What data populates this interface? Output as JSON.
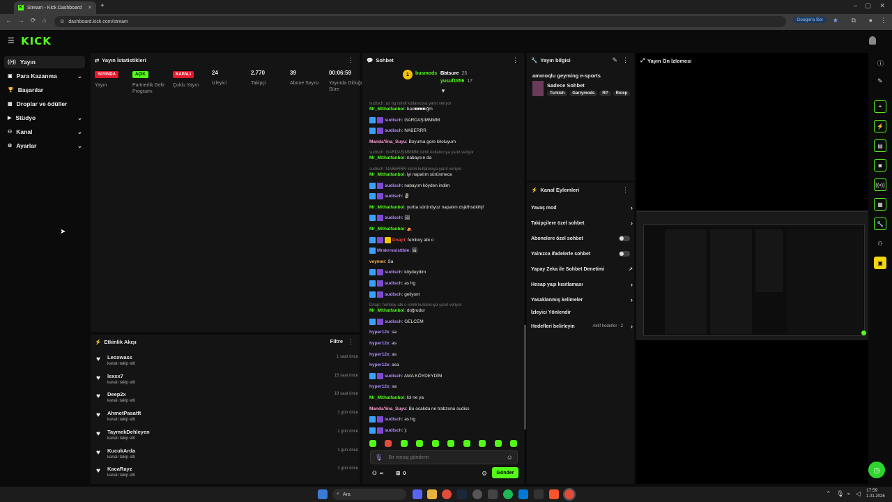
{
  "browser": {
    "tab_title": "Stream - Kick Dashboard",
    "url": "dashboard.kick.com/stream",
    "google_button": "Google'a Sor"
  },
  "app": {
    "logo": "KICK"
  },
  "sidebar": {
    "items": [
      {
        "label": "Yayın",
        "icon": "broadcast-icon",
        "chevron": false,
        "active": true
      },
      {
        "label": "Para Kazanma",
        "icon": "money-icon",
        "chevron": true
      },
      {
        "label": "Başarılar",
        "icon": "trophy-icon",
        "chevron": false
      },
      {
        "label": "Droplar ve ödüller",
        "icon": "gift-icon",
        "chevron": false
      },
      {
        "label": "Stüdyo",
        "icon": "camera-icon",
        "chevron": true
      },
      {
        "label": "Kanal",
        "icon": "channel-icon",
        "chevron": true
      },
      {
        "label": "Ayarlar",
        "icon": "gear-icon",
        "chevron": true
      }
    ]
  },
  "stats": {
    "title": "Yayın İstatistikleri",
    "items": [
      {
        "badge": "YAYINDA",
        "badge_color": "#e3192c",
        "label": "Yayın"
      },
      {
        "badge": "AÇIK",
        "badge_color": "#53fc18",
        "label": "Partnerlik Gelir Programı"
      },
      {
        "badge": "KAPALI",
        "badge_color": "#e3192c",
        "label": "Çoklu Yayın"
      },
      {
        "value": "24",
        "label": "İzleyici"
      },
      {
        "value": "2.770",
        "label": "Takipçi"
      },
      {
        "value": "39",
        "label": "Abone Sayısı"
      },
      {
        "value": "00:06:59",
        "label": "Yayında Olduğu Süre"
      }
    ]
  },
  "activity": {
    "title": "Etkinlik Akışı",
    "filter": "Filtre",
    "items": [
      {
        "name": "Leoxwass",
        "sub": "kanalı takip etti",
        "time": "1 saat önce"
      },
      {
        "name": "lexxx7",
        "sub": "kanalı takip etti",
        "time": "15 saat önce"
      },
      {
        "name": "Deep2x",
        "sub": "kanalı takip etti",
        "time": "19 saat önce"
      },
      {
        "name": "AhmetPasatft",
        "sub": "kanalı takip etti",
        "time": "1 gün önce"
      },
      {
        "name": "TaymekDehleyen",
        "sub": "kanalı takip etti",
        "time": "1 gün önce"
      },
      {
        "name": "KucukArda",
        "sub": "kanalı takip etti",
        "time": "1 gün önce"
      },
      {
        "name": "KacaRayz",
        "sub": "kanalı takip etti",
        "time": "1 gün önce"
      }
    ]
  },
  "chat": {
    "title": "Sohbet",
    "top_gifters": [
      {
        "name": "busmods",
        "count": "38"
      },
      {
        "name": "Gatsure",
        "count": "25"
      },
      {
        "name": "yusuf1856",
        "count": "17"
      }
    ],
    "messages": [
      {
        "reply": "sudisch: as hg isimli kullanıcıya yanıt veriyor"
      },
      {
        "user": "Mr_Mithatfanboi",
        "color": "#53fc18",
        "text": "bac■■■■ığm"
      },
      {
        "user": "sudisch",
        "color": "#b38aff",
        "text": "GARDAŞIMMMM",
        "badges": 2
      },
      {
        "user": "sudisch",
        "color": "#b38aff",
        "text": "NABERRR",
        "badges": 2
      },
      {
        "user": "Manda'lina_Suyu",
        "color": "#ff9bd0",
        "text": "Boyuma gore kiloluyum"
      },
      {
        "reply": "sudisch: GARDAŞIMMMM isimli kullanıcıya yanıt veriyor"
      },
      {
        "user": "Mr_Mithatfanboi",
        "color": "#53fc18",
        "text": "nabaysın da"
      },
      {
        "reply": "sudisch: NABERRR isimli kullanıcıya yanıt veriyor"
      },
      {
        "user": "Mr_Mithatfanboi",
        "color": "#53fc18",
        "text": "iyi napalım sürünmece"
      },
      {
        "user": "sudisch",
        "color": "#b38aff",
        "text": "nabayım köyden indim",
        "badges": 2
      },
      {
        "user": "sudisch",
        "color": "#b38aff",
        "text": "🗿",
        "badges": 2
      },
      {
        "user": "Mr_Mithatfanboi",
        "color": "#53fc18",
        "text": "yurtta sürünüyoz napalım dsjkfhsdklhjf"
      },
      {
        "user": "sudisch",
        "color": "#b38aff",
        "text": "🖼",
        "badges": 2
      },
      {
        "user": "Mr_Mithatfanboi",
        "color": "#53fc18",
        "text": "⛺"
      },
      {
        "user": "Dnajri",
        "color": "#ff3b3b",
        "text": "femboy abi o",
        "badges": 3
      },
      {
        "user": "Mrskrresistible",
        "color": "#b38aff",
        "text": "🖼",
        "badges": 1
      },
      {
        "user": "veymer",
        "color": "#ffb347",
        "text": "Sa"
      },
      {
        "user": "sudisch",
        "color": "#b38aff",
        "text": "köydeydim",
        "badges": 2
      },
      {
        "user": "sudisch",
        "color": "#b38aff",
        "text": "as hg",
        "badges": 2
      },
      {
        "user": "sudisch",
        "color": "#b38aff",
        "text": "geliyom",
        "badges": 2
      },
      {
        "reply": "Dnajri: femboy abi o isimli kullanıcıya yanıt veriyor"
      },
      {
        "user": "Mr_Mithatfanboi",
        "color": "#53fc18",
        "text": "doğrudur"
      },
      {
        "user": "sudisch",
        "color": "#b38aff",
        "text": "GELCEM",
        "badges": 2
      },
      {
        "user": "hyper12x",
        "color": "#b38aff",
        "text": "sa"
      },
      {
        "user": "hyper12x",
        "color": "#b38aff",
        "text": "as"
      },
      {
        "user": "hyper12x",
        "color": "#b38aff",
        "text": "as"
      },
      {
        "user": "hyper12x",
        "color": "#b38aff",
        "text": "asa"
      },
      {
        "user": "sudisch",
        "color": "#b38aff",
        "text": "AMA KÖYDEYDİM",
        "badges": 2
      },
      {
        "user": "hyper12x",
        "color": "#b38aff",
        "text": "sa"
      },
      {
        "user": "Mr_Mithatfanboi",
        "color": "#53fc18",
        "text": "lol ne ya"
      },
      {
        "user": "Manda'lina_Suyu",
        "color": "#ff9bd0",
        "text": "Bu ocakda ne trabzonu sudiss"
      },
      {
        "user": "sudisch",
        "color": "#b38aff",
        "text": "as hg",
        "badges": 2
      },
      {
        "user": "sudisch",
        "color": "#b38aff",
        "text": "):",
        "badges": 2
      }
    ],
    "input_placeholder": "Bir mesaj gönderin",
    "viewer_count": "∞",
    "gift_count": "0",
    "send_label": "Gönder"
  },
  "stream_info": {
    "title": "Yayın bilgisi",
    "stream_title": "amınoqlu geyming e-sports",
    "category": "Sadece Sohbet",
    "tags": [
      "Turkish",
      "Garrymods",
      "RP",
      "Rolep"
    ]
  },
  "channel_actions": {
    "title": "Kanal Eylemleri",
    "items": [
      {
        "label": "Yavaş mod",
        "type": "arrow"
      },
      {
        "label": "Takipçilere özel sohbet",
        "type": "arrow"
      },
      {
        "label": "Abonelere özel sohbet",
        "type": "toggle"
      },
      {
        "label": "Yalnızca ifadelerle sohbet",
        "type": "toggle"
      },
      {
        "label": "Yapay Zeka ile Sohbet Denetimi",
        "type": "external"
      },
      {
        "label": "Hesap yaşı kısıtlaması",
        "type": "arrow"
      },
      {
        "label": "Yasaklanmış kelimeler",
        "type": "arrow"
      },
      {
        "label": "İzleyici Yönlendir",
        "type": "none"
      },
      {
        "label": "Hedefleri belirleyin",
        "type": "arrow",
        "extra": "Aktif hedefler - 2"
      }
    ]
  },
  "preview": {
    "title": "Yayın Ön İzlemesi"
  },
  "taskbar": {
    "search": "Ara",
    "time": "17:59",
    "date": "1.01.2026"
  }
}
